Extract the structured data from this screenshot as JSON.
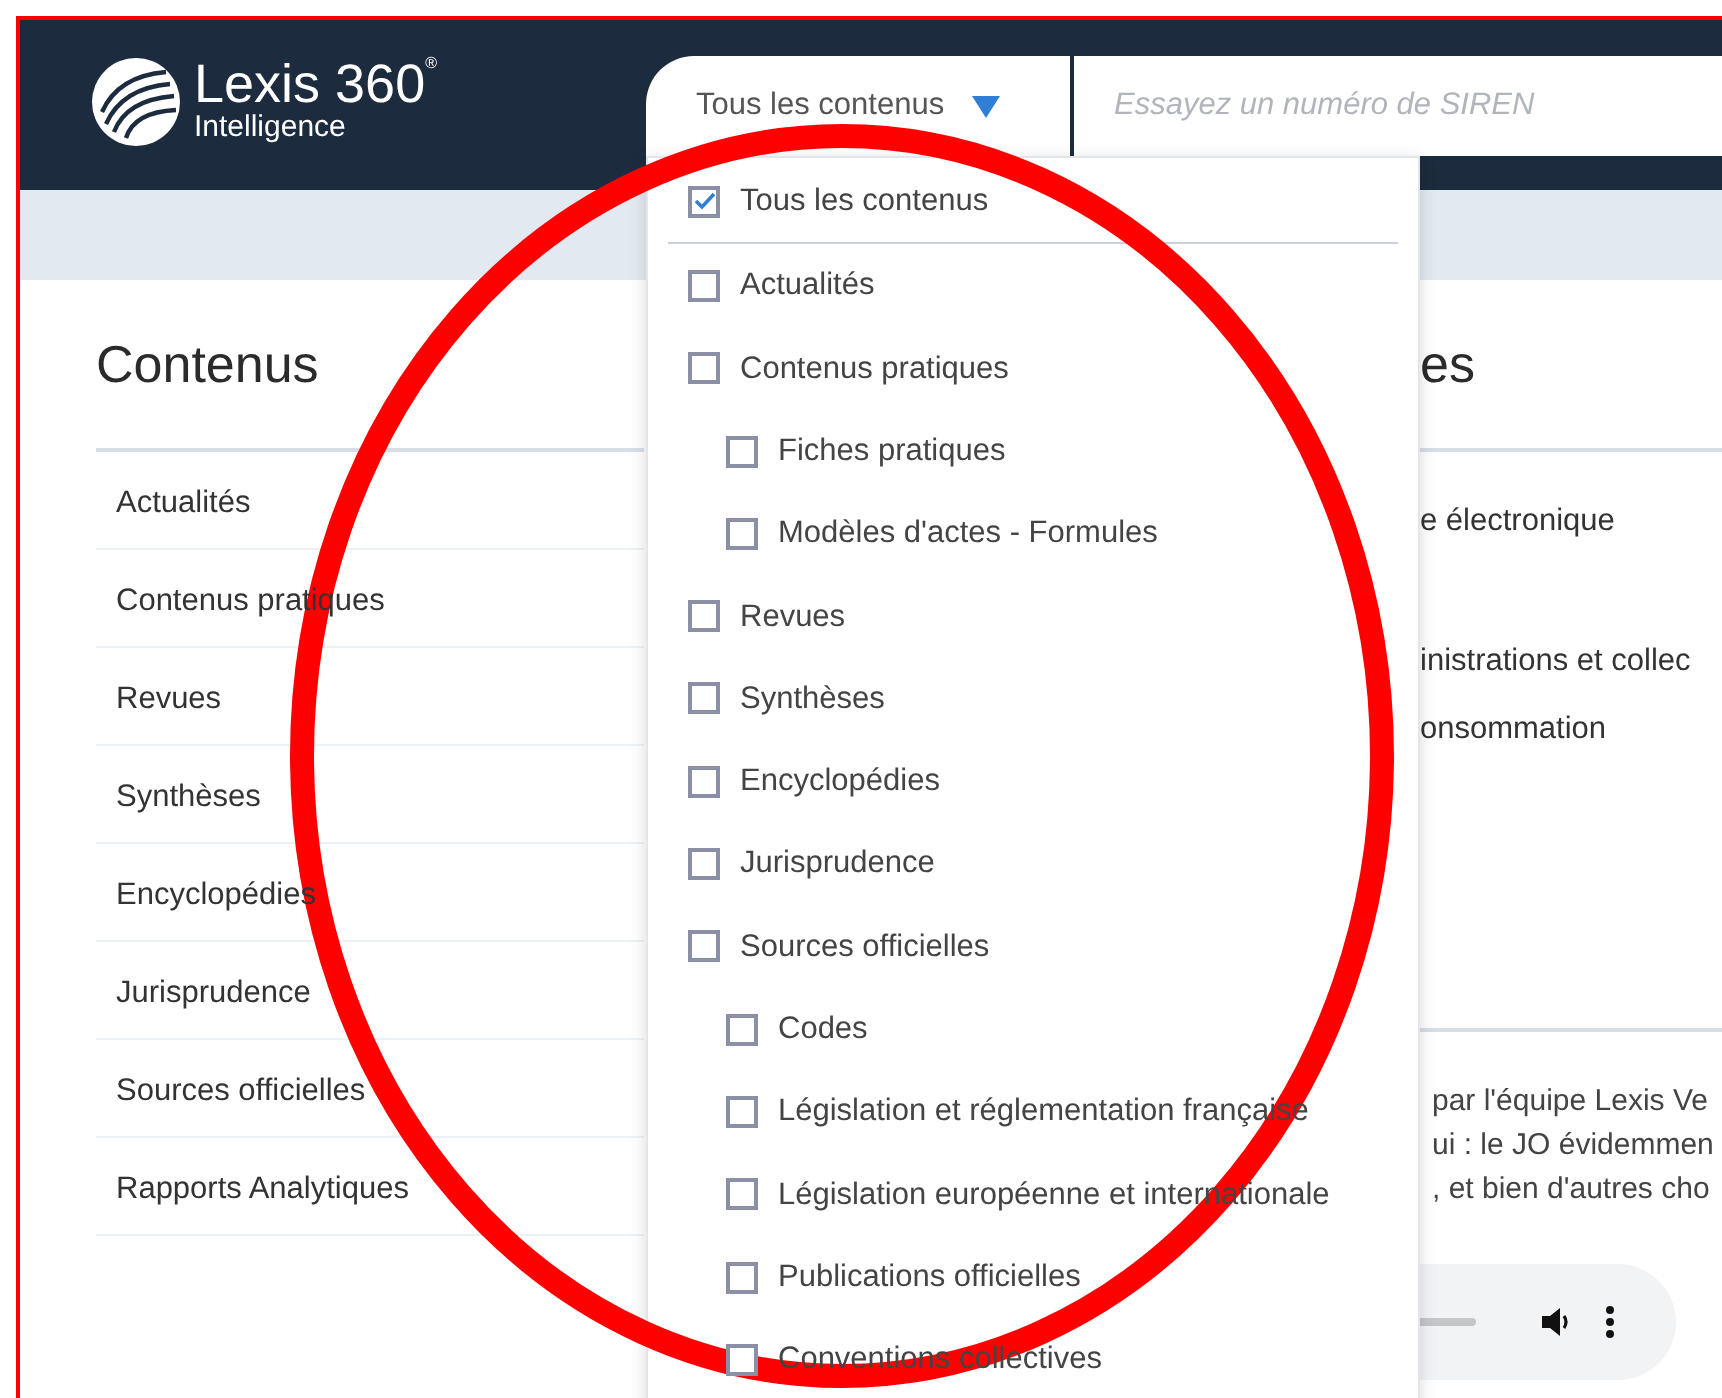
{
  "header": {
    "logo": {
      "name": "Lexis 360",
      "mark": "®",
      "tagline": "Intelligence"
    },
    "scope_select": {
      "value": "Tous les contenus",
      "expanded": true
    },
    "search": {
      "placeholder": "Essayez un numéro de SIREN"
    }
  },
  "contents_panel": {
    "title": "Contenus",
    "items": [
      "Actualités",
      "Contenus pratiques",
      "Revues",
      "Synthèses",
      "Encyclopédies",
      "Jurisprudence",
      "Sources officielles",
      "Rapports Analytiques"
    ]
  },
  "scope_menu": {
    "items": [
      {
        "label": "Tous les contenus",
        "checked": true
      },
      {
        "label": "Actualités",
        "checked": false
      },
      {
        "label": "Contenus pratiques",
        "checked": false,
        "children": [
          {
            "label": "Fiches pratiques",
            "checked": false
          },
          {
            "label": "Modèles d'actes - Formules",
            "checked": false
          }
        ]
      },
      {
        "label": "Revues",
        "checked": false
      },
      {
        "label": "Synthèses",
        "checked": false
      },
      {
        "label": "Encyclopédies",
        "checked": false
      },
      {
        "label": "Jurisprudence",
        "checked": false
      },
      {
        "label": "Sources officielles",
        "checked": false,
        "children": [
          {
            "label": "Codes",
            "checked": false
          },
          {
            "label": "Législation et réglementation française",
            "checked": false
          },
          {
            "label": "Législation européenne et internationale",
            "checked": false
          },
          {
            "label": "Publications officielles",
            "checked": false
          },
          {
            "label": "Conventions collectives",
            "checked": false
          }
        ]
      }
    ]
  },
  "right_panel": {
    "title": "es",
    "lines": [
      "e électronique",
      "inistrations et collec",
      "onsommation"
    ],
    "paragraph": [
      "par l'équipe Lexis Ve",
      "ui : le JO évidemmen",
      ", et bien d'autres cho"
    ]
  },
  "annotation": {
    "kind": "ellipse",
    "color": "#ff0000"
  }
}
